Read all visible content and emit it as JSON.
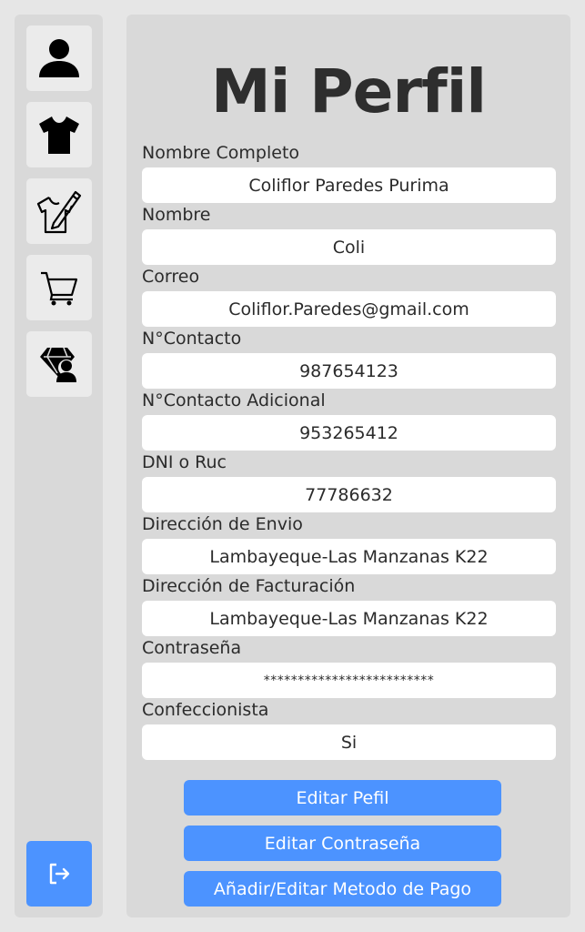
{
  "sidebar": {
    "items": [
      {
        "icon": "user-icon"
      },
      {
        "icon": "tshirt-icon"
      },
      {
        "icon": "tshirt-design-icon"
      },
      {
        "icon": "cart-icon"
      },
      {
        "icon": "diamond-user-icon"
      }
    ],
    "logout_icon": "logout-icon"
  },
  "profile": {
    "title": "Mi Perfil",
    "fields": [
      {
        "label": "Nombre Completo",
        "value": "Coliflor Paredes Purima"
      },
      {
        "label": "Nombre",
        "value": "Coli"
      },
      {
        "label": "Correo",
        "value": "Coliflor.Paredes@gmail.com"
      },
      {
        "label": "N°Contacto",
        "value": "987654123"
      },
      {
        "label": "N°Contacto Adicional",
        "value": "953265412"
      },
      {
        "label": "DNI o Ruc",
        "value": "77786632"
      },
      {
        "label": "Dirección de Envio",
        "value": "Lambayeque-Las Manzanas K22"
      },
      {
        "label": "Dirección de Facturación",
        "value": "Lambayeque-Las Manzanas K22"
      },
      {
        "label": "Contraseña",
        "value": "*************************"
      },
      {
        "label": "Confeccionista",
        "value": "Si"
      }
    ],
    "buttons": {
      "edit_profile": "Editar Pefil",
      "edit_password": "Editar Contraseña",
      "payment_method": "Añadir/Editar Metodo de Pago"
    }
  },
  "colors": {
    "accent": "#4c93ff",
    "panel": "#d9d9d9",
    "background": "#e6e6e6"
  }
}
